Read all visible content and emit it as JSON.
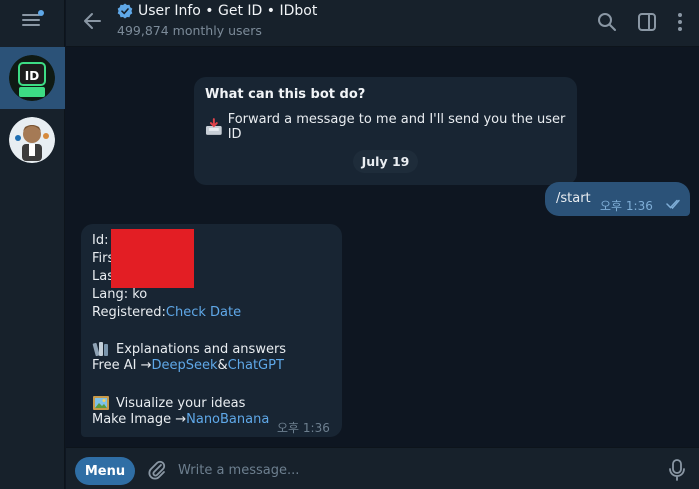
{
  "header": {
    "title": "User Info • Get ID • IDbot",
    "subtitle": "499,874 monthly users"
  },
  "sidebar": {
    "chats": [
      {
        "avatar": "idbot-avatar",
        "active": true
      },
      {
        "avatar": "user-avatar",
        "active": false
      }
    ]
  },
  "intro": {
    "title": "What can this bot do?",
    "text": "Forward a message to me and I'll send you the user ID"
  },
  "date_separator": "July 19",
  "outgoing": {
    "text": "/start",
    "time": "오후 1:36"
  },
  "incoming": {
    "id_label": "Id: ",
    "first_label": "Firs",
    "last_label": "Las",
    "lang": "Lang: ko",
    "registered_label": "Registered: ",
    "registered_link": "Check Date",
    "explain": "Explanations and answers",
    "free_ai_prefix": "Free AI → ",
    "deepseek": "DeepSeek",
    "amp": " & ",
    "chatgpt": "ChatGPT",
    "visualize": "Visualize your ideas",
    "make_image_prefix": "Make Image → ",
    "nanobanana": "NanoBanana",
    "time": "오후 1:36"
  },
  "composer": {
    "menu_label": "Menu",
    "placeholder": "Write a message..."
  },
  "colors": {
    "accent": "#5fa8e8",
    "outgoing_bubble": "#2b5278",
    "incoming_bubble": "#182533",
    "background": "#0e1621",
    "redaction": "#e31e24"
  }
}
